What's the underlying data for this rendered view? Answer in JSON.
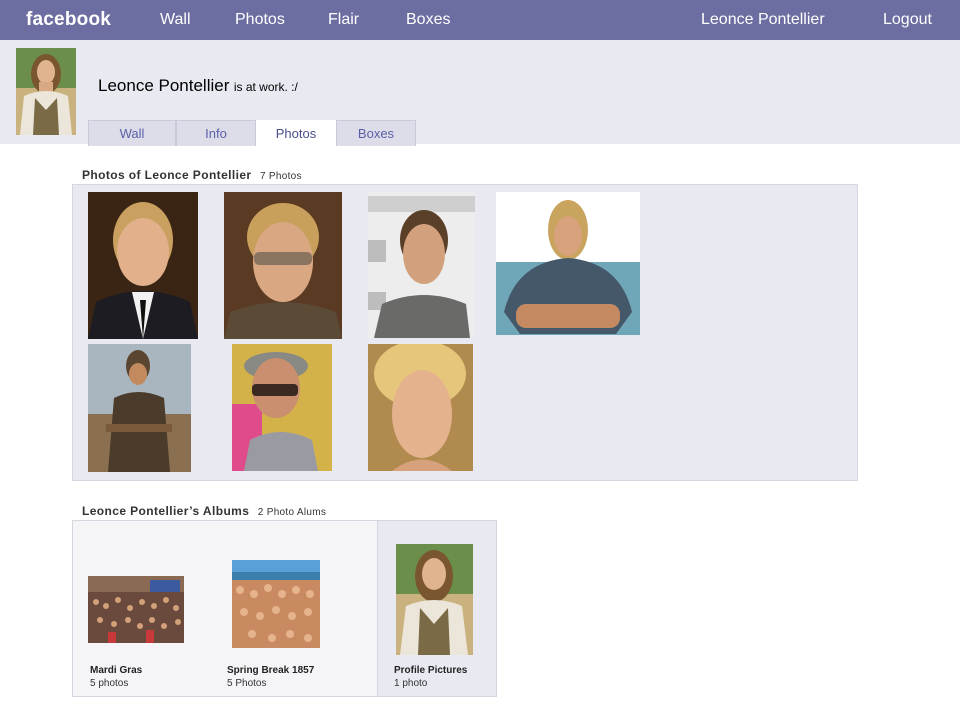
{
  "topbar": {
    "logo": "facebook",
    "nav": [
      "Wall",
      "Photos",
      "Flair",
      "Boxes"
    ],
    "user": "Leonce Pontellier",
    "logout": "Logout",
    "color": "#6c6da1"
  },
  "profile": {
    "name": "Leonce Pontellier",
    "status": "is at work. :/"
  },
  "tabs": [
    "Wall",
    "Info",
    "Photos",
    "Boxes"
  ],
  "active_tab": "Photos",
  "photos_section": {
    "title": "Photos of Leonce Pontellier",
    "count": "7 Photos"
  },
  "albums_section": {
    "title": "Leonce Pontellier’s Albums",
    "count": "2 Photo Alums",
    "albums": [
      {
        "name": "Mardi Gras",
        "count": "5 photos"
      },
      {
        "name": "Spring Break 1857",
        "count": "5 Photos"
      },
      {
        "name": "Profile Pictures",
        "count": "1 photo"
      }
    ]
  }
}
